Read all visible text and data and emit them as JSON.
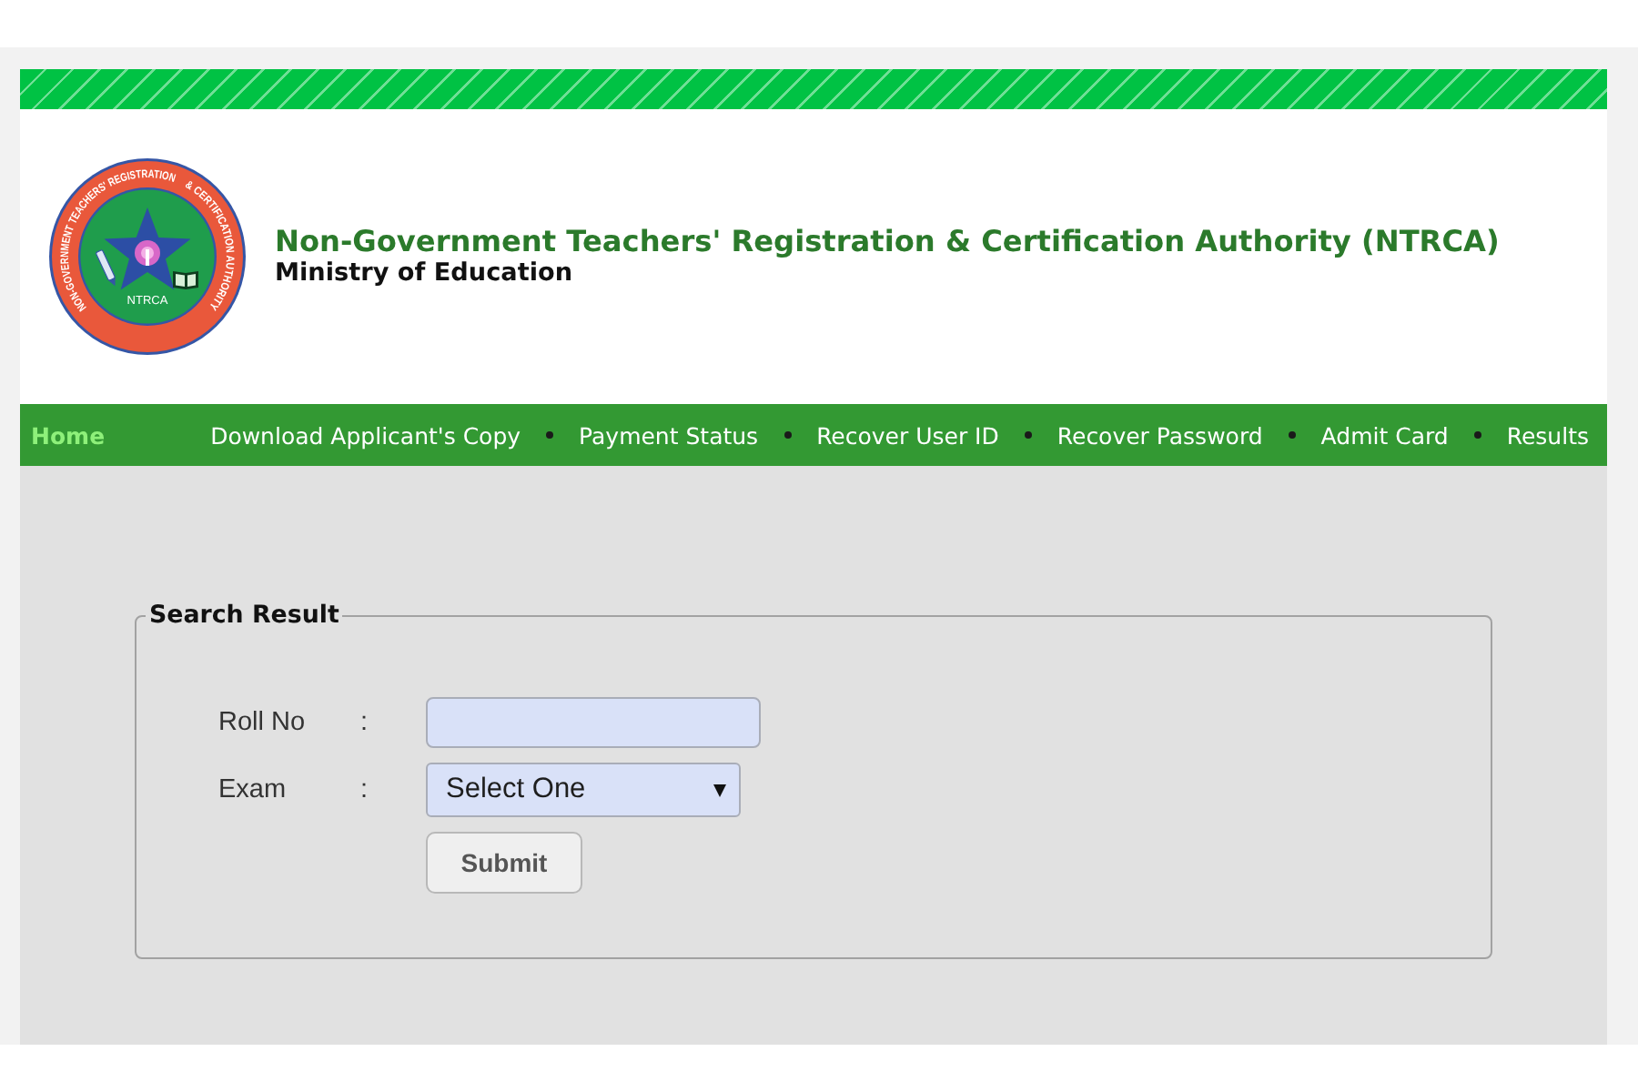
{
  "header": {
    "logo": {
      "ring_text": [
        "NON-GOVERNMENT TEACHERS' REGISTRATION",
        "& CERTIFICATION AUTHORITY"
      ],
      "center_text": "NTRCA"
    },
    "title": "Non-Government Teachers' Registration & Certification Authority (NTRCA)",
    "subtitle": "Ministry of Education"
  },
  "nav": [
    {
      "label": "Home",
      "selected": true
    },
    {
      "label": "Download Applicant's Copy",
      "selected": false
    },
    {
      "label": "Payment Status",
      "selected": false
    },
    {
      "label": "Recover User ID",
      "selected": false
    },
    {
      "label": "Recover Password",
      "selected": false
    },
    {
      "label": "Admit Card",
      "selected": false
    },
    {
      "label": "Results",
      "selected": false
    }
  ],
  "search_panel": {
    "title": "Search Result",
    "fields": [
      {
        "kind": "text",
        "label": "Roll No",
        "colon": ":"
      },
      {
        "kind": "select",
        "label": "Exam",
        "colon": ":",
        "value": "Select One"
      }
    ],
    "submit": "Submit"
  }
}
